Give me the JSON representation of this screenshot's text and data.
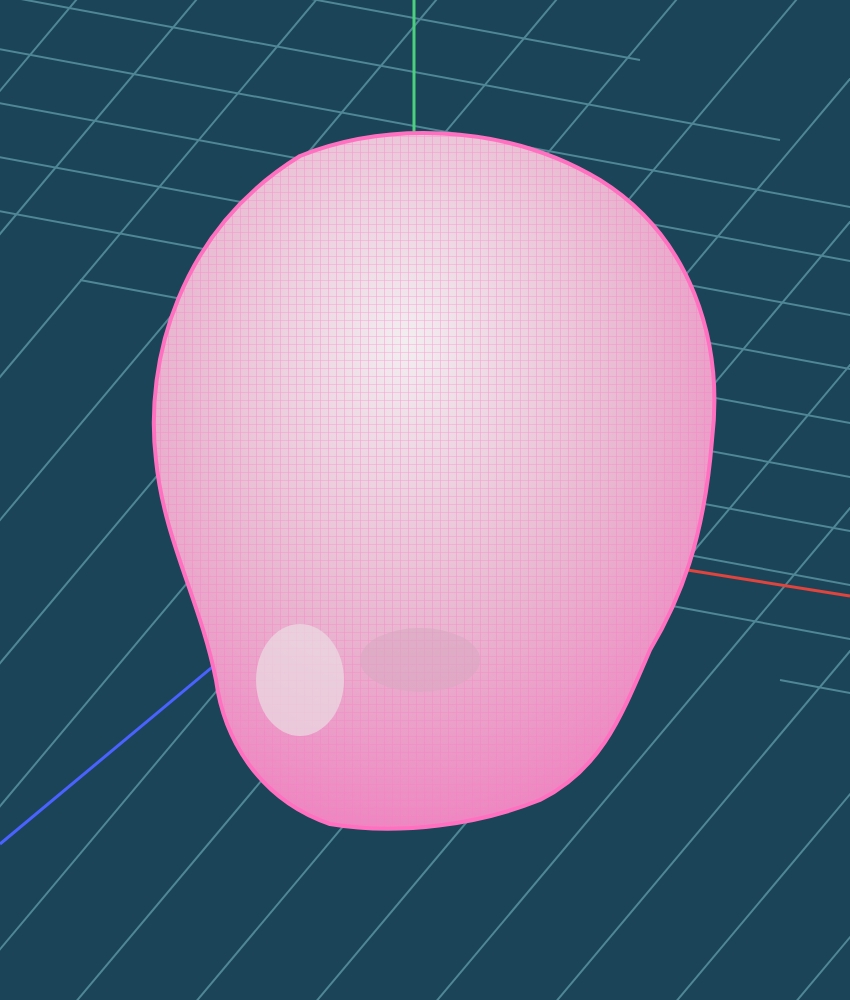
{
  "viewport": {
    "show_grid": true,
    "show_axes": true,
    "show_mesh": true
  }
}
